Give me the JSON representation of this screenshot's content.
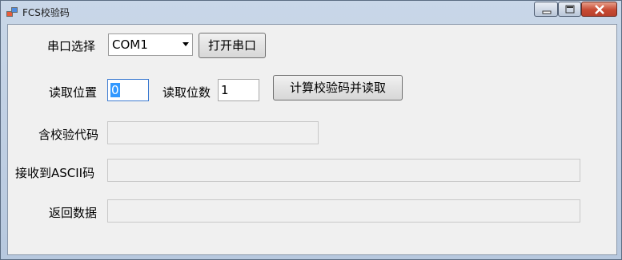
{
  "window": {
    "title": "FCS校验码",
    "icon": "app-window-icon",
    "controls": [
      "minimize-icon",
      "maximize-icon",
      "close-icon"
    ]
  },
  "serial": {
    "port_label": "串口选择",
    "port_value": "COM1",
    "open_button": "打开串口"
  },
  "read": {
    "position_label": "读取位置",
    "position_value": "0",
    "count_label": "读取位数",
    "count_value": "1",
    "compute_button": "计算校验码并读取"
  },
  "fields": {
    "fcs_code_label": "含校验代码",
    "fcs_code_value": "",
    "ascii_label": "接收到ASCII码",
    "ascii_value": "",
    "return_label": "返回数据",
    "return_value": ""
  },
  "colors": {
    "selection": "#3399ff",
    "close_button": "#c74a33",
    "client_background": "#f0f0f0"
  }
}
